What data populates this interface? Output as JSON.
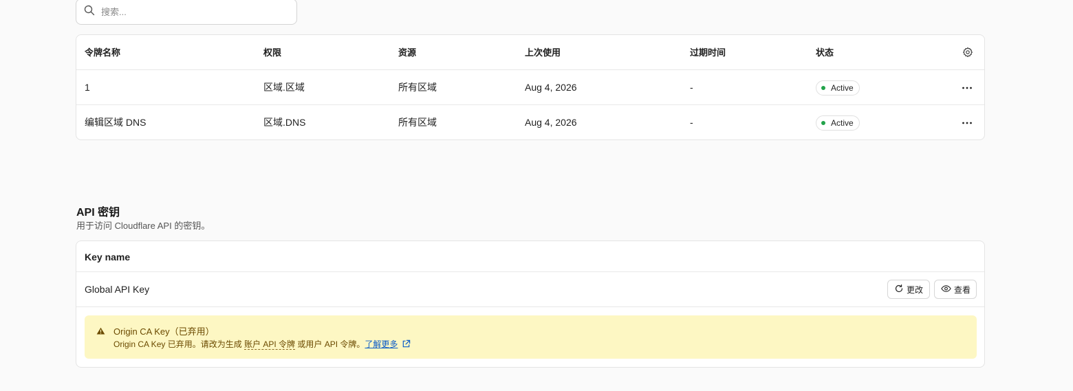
{
  "search": {
    "placeholder": "搜索..."
  },
  "tokens_table": {
    "columns": [
      "令牌名称",
      "权限",
      "资源",
      "上次使用",
      "过期时间",
      "状态"
    ],
    "rows": [
      {
        "name": "1",
        "permission": "区域.区域",
        "resources": "所有区域",
        "last_used": "Aug 4, 2026",
        "expires": "-",
        "status": "Active"
      },
      {
        "name": "编辑区域 DNS",
        "permission": "区域.DNS",
        "resources": "所有区域",
        "last_used": "Aug 4, 2026",
        "expires": "-",
        "status": "Active"
      }
    ]
  },
  "api_keys": {
    "title": "API 密钥",
    "subtitle": "用于访问 Cloudflare API 的密钥。",
    "column_header": "Key name",
    "rows": [
      {
        "name": "Global API Key",
        "change_label": "更改",
        "view_label": "查看"
      }
    ],
    "notice": {
      "title": "Origin CA Key（已弃用）",
      "text_before": "Origin CA Key 已弃用。请改为生成 ",
      "link_account_token": "账户 API 令牌",
      "text_middle": " 或用户 API 令牌。",
      "learn_more": "了解更多"
    }
  },
  "colors": {
    "status_active": "#22a34a",
    "notice_bg": "#fdf7c3",
    "link": "#0b5cc8"
  },
  "icons": [
    "search-icon",
    "gear-icon",
    "more-icon",
    "refresh-icon",
    "eye-icon",
    "warning-icon",
    "external-link-icon"
  ]
}
